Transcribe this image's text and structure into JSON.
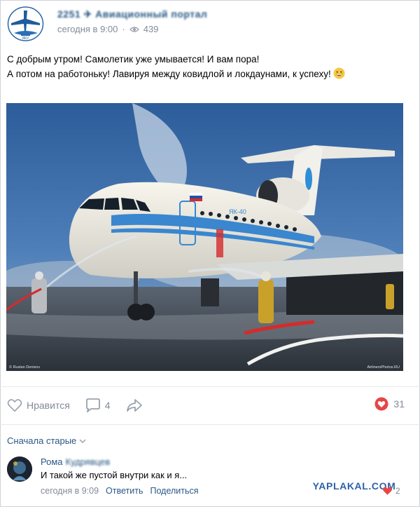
{
  "post": {
    "group_name": "2251 ✈ Авиационный портал",
    "time": "сегодня в 9:00",
    "views": "439",
    "text_line1": "С добрым утром! Самолетик уже умывается! И вам пора!",
    "text_line2": "А потом на работоньку! Лавируя между ковидлой и локдаунами, к успеху!",
    "emoji_icon": "grinning-face-emoji"
  },
  "photo": {
    "caption_left": "© Ruslan Denisov",
    "caption_right": "AirlinersPhotos.RU",
    "livery_text": "ЯК-40"
  },
  "actions": {
    "like_label": "Нравится",
    "comments_count": "4",
    "likes_count": "31",
    "accent_red": "#e64646"
  },
  "comments": {
    "sort_label": "Сначала старые",
    "items": [
      {
        "author_first": "Рома",
        "author_last": "Кудрявцев",
        "text": "И такой же пустой внутри как и я...",
        "time": "сегодня в 9:09",
        "reply": "Ответить",
        "share": "Поделиться",
        "likes": "2"
      }
    ]
  },
  "watermark": "YAPLAKAL.COM"
}
